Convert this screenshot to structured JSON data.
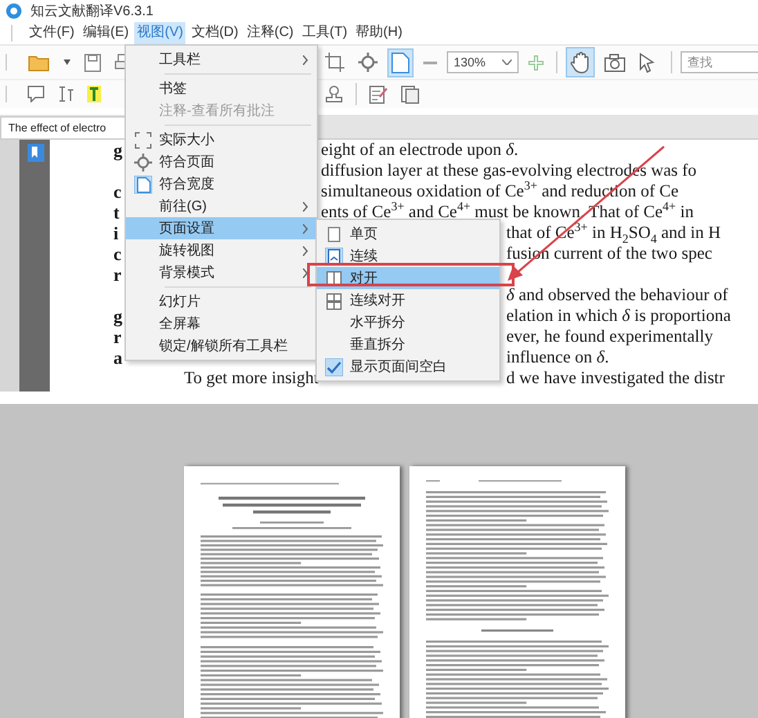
{
  "window": {
    "title": "知云文献翻译V6.3.1"
  },
  "menubar": [
    {
      "label": "文件(F)",
      "selected": false
    },
    {
      "label": "编辑(E)",
      "selected": false
    },
    {
      "label": "视图(V)",
      "selected": true
    },
    {
      "label": "文档(D)",
      "selected": false
    },
    {
      "label": "注释(C)",
      "selected": false
    },
    {
      "label": "工具(T)",
      "selected": false
    },
    {
      "label": "帮助(H)",
      "selected": false
    }
  ],
  "toolbar": {
    "view_tools": [
      {
        "selected": false
      },
      {
        "selected": false
      },
      {
        "selected": true
      }
    ],
    "zoom": "130%",
    "mouse_tools": [
      {
        "selected": true
      },
      {
        "selected": false
      },
      {
        "selected": false
      }
    ],
    "search": {
      "placeholder": "查找"
    }
  },
  "tabs": [
    {
      "label": "The effect of electro",
      "selected": true
    }
  ],
  "menu": [
    {
      "label": "工具栏",
      "kind": "submenu",
      "selected": false,
      "disabled": false
    },
    {
      "kind": "separator"
    },
    {
      "label": "书签",
      "kind": "item",
      "selected": false,
      "disabled": false
    },
    {
      "label": "注释-查看所有批注",
      "kind": "item",
      "selected": false,
      "disabled": true
    },
    {
      "kind": "separator"
    },
    {
      "label": "实际大小",
      "kind": "actual-size",
      "selected": false,
      "disabled": false,
      "checked": false
    },
    {
      "label": "符合页面",
      "kind": "fit-page",
      "selected": false,
      "disabled": false,
      "checked": false
    },
    {
      "label": "符合宽度",
      "kind": "fit-width",
      "selected": false,
      "disabled": false,
      "checked": true
    },
    {
      "label": "前往(G)",
      "kind": "submenu",
      "selected": false,
      "disabled": false
    },
    {
      "label": "页面设置",
      "kind": "submenu",
      "selected": true,
      "disabled": false
    },
    {
      "label": "旋转视图",
      "kind": "submenu",
      "selected": false,
      "disabled": false
    },
    {
      "label": "背景模式",
      "kind": "submenu",
      "selected": false,
      "disabled": false
    },
    {
      "kind": "separator"
    },
    {
      "label": "幻灯片",
      "kind": "item",
      "selected": false,
      "disabled": false
    },
    {
      "label": "全屏幕",
      "kind": "item",
      "selected": false,
      "disabled": false
    },
    {
      "label": "锁定/解锁所有工具栏",
      "kind": "item",
      "selected": false,
      "disabled": false
    }
  ],
  "submenu": [
    {
      "label": "单页",
      "kind": "single-page",
      "selected": false,
      "checked": false,
      "outlined": false
    },
    {
      "label": "连续",
      "kind": "continuous",
      "selected": false,
      "checked": true,
      "outlined": false
    },
    {
      "label": "对开",
      "kind": "facing",
      "selected": true,
      "checked": false,
      "outlined": true
    },
    {
      "label": "连续对开",
      "kind": "continuous-facing",
      "selected": false,
      "checked": false,
      "outlined": false
    },
    {
      "label": "水平拆分",
      "kind": "item",
      "selected": false,
      "checked": false,
      "outlined": false
    },
    {
      "label": "垂直拆分",
      "kind": "item",
      "selected": false,
      "checked": false,
      "outlined": false
    },
    {
      "label": "显示页面间空白",
      "kind": "check",
      "selected": false,
      "checked": true,
      "outlined": false
    }
  ],
  "document_lines": [
    {
      "kind": "full",
      "left": "g",
      "text": "eight of an electrode upon *δ*."
    },
    {
      "kind": "full",
      "text": "diffusion layer at these gas-evolving electrodes was fo"
    },
    {
      "kind": "full",
      "left": "c",
      "text": "simultaneous oxidation of Ce$^{3+}$ and reduction of Ce"
    },
    {
      "kind": "full",
      "left": "t",
      "text": "ents of Ce$^{3+}$ and Ce$^{4+}$ must be known.  That of Ce$^{4+}$ in"
    },
    {
      "kind": "partial",
      "left": "i",
      "text": "that of Ce$^{3+}$ in H$_{2}$SO$_{4}$ and in H"
    },
    {
      "kind": "partial",
      "left": "c",
      "text": "fusion current of the two spec"
    },
    {
      "kind": "partial",
      "left": "r"
    },
    {
      "kind": "partial",
      "text": "*δ* and observed the behaviour of"
    },
    {
      "kind": "partial",
      "left": "g",
      "text": "elation in which *δ* is proportiona"
    },
    {
      "kind": "partial",
      "left": "r",
      "text": "ever, he found experimentally"
    },
    {
      "kind": "partial",
      "left": "a",
      "text": "influence on *δ*."
    },
    {
      "kind": "split",
      "left": "To get more insight",
      "text": "d we have investigated the distr"
    }
  ],
  "preview": {
    "pages": [
      {
        "kind": "title-page"
      },
      {
        "kind": "text-page"
      }
    ]
  }
}
